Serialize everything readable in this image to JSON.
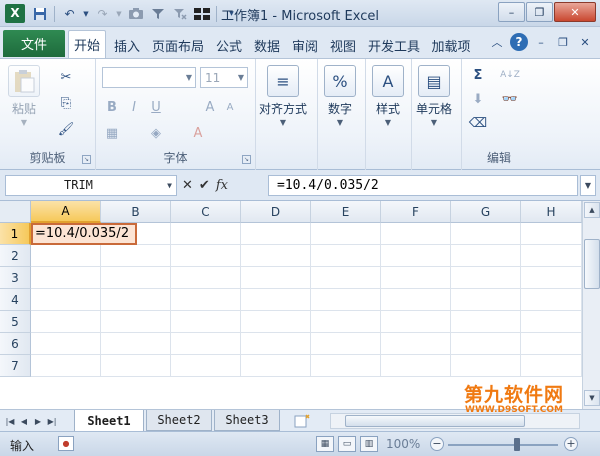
{
  "app": {
    "title": "工作簿1 - Microsoft Excel",
    "logo": "X",
    "qat_icons": [
      "save-icon",
      "undo-icon",
      "redo-icon",
      "camera-icon",
      "filter-icon",
      "filter-remove-icon",
      "freeze-panes-icon",
      "customize-qat-icon"
    ],
    "window_controls": {
      "minimize": "–",
      "restore": "❐",
      "close": "✕"
    }
  },
  "ribbon": {
    "file_tab": "文件",
    "tabs": [
      "开始",
      "插入",
      "页面布局",
      "公式",
      "数据",
      "审阅",
      "视图",
      "开发工具",
      "加载项"
    ],
    "active_tab": "开始",
    "groups": {
      "clipboard": {
        "label": "剪贴板",
        "paste": "粘贴"
      },
      "font": {
        "label": "字体",
        "font_name": "",
        "font_size": "11",
        "bold": "B",
        "italic": "I",
        "underline": "U",
        "grow": "A",
        "shrink": "A"
      },
      "alignment": {
        "label": "对齐方式"
      },
      "number": {
        "label": "数字",
        "icon_text": "%"
      },
      "styles": {
        "label": "样式",
        "icon_text": "A"
      },
      "cells": {
        "label": "单元格"
      },
      "editing": {
        "label": "编辑",
        "sum_icon": "Σ",
        "sort_icon": "A↓Z"
      }
    }
  },
  "formula_bar": {
    "name_box": "TRIM",
    "cancel_symbol": "✕",
    "enter_symbol": "✔",
    "fx_symbol": "fx",
    "formula": "=10.4/0.035/2"
  },
  "grid": {
    "columns": [
      "A",
      "B",
      "C",
      "D",
      "E",
      "F",
      "G",
      "H"
    ],
    "rows": [
      "1",
      "2",
      "3",
      "4",
      "5",
      "6",
      "7"
    ],
    "selected_column": "A",
    "selected_row": "1",
    "active_cell": {
      "address": "A1",
      "value": "=10.4/0.035/2"
    }
  },
  "sheets": {
    "tabs": [
      "Sheet1",
      "Sheet2",
      "Sheet3"
    ],
    "active": "Sheet1"
  },
  "status_bar": {
    "mode": "输入",
    "zoom": "100%",
    "zoom_level": 100,
    "zoom_minus": "−",
    "zoom_plus": "+"
  },
  "watermark": {
    "main": "第九软件网",
    "sub": "WWW.D9SOFT.COM",
    "color": "#f07a12"
  },
  "colors": {
    "file_tab": "#1e6b3c",
    "selection_header": "#f6c95b",
    "active_cell_border": "#c96a3a",
    "active_cell_fill": "#fce4d4"
  }
}
